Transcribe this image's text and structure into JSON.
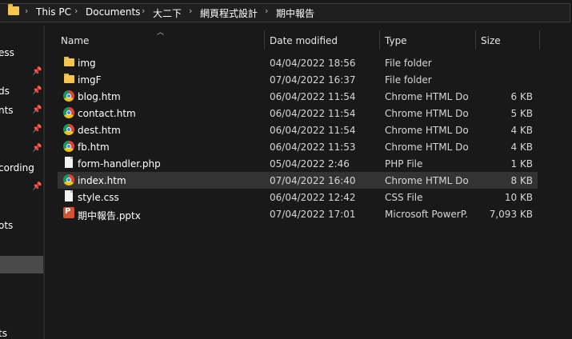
{
  "address": {
    "crumbs": [
      "This PC",
      "Documents",
      "大二下",
      "網頁程式設計",
      "期中報告"
    ]
  },
  "nav": {
    "items": [
      "ess",
      "ds",
      "nts",
      "cording",
      "ots",
      "ts"
    ]
  },
  "columns": {
    "name": "Name",
    "date": "Date modified",
    "type": "Type",
    "size": "Size"
  },
  "files": [
    {
      "name": "img",
      "date": "04/04/2022 18:56",
      "type": "File folder",
      "size": "",
      "icon": "folder-icon"
    },
    {
      "name": "imgF",
      "date": "07/04/2022 16:37",
      "type": "File folder",
      "size": "",
      "icon": "folder-icon"
    },
    {
      "name": "blog.htm",
      "date": "06/04/2022 11:54",
      "type": "Chrome HTML Do...",
      "size": "6 KB",
      "icon": "chrome-icon"
    },
    {
      "name": "contact.htm",
      "date": "06/04/2022 11:54",
      "type": "Chrome HTML Do...",
      "size": "5 KB",
      "icon": "chrome-icon"
    },
    {
      "name": "dest.htm",
      "date": "06/04/2022 11:54",
      "type": "Chrome HTML Do...",
      "size": "4 KB",
      "icon": "chrome-icon"
    },
    {
      "name": "fb.htm",
      "date": "06/04/2022 11:53",
      "type": "Chrome HTML Do...",
      "size": "4 KB",
      "icon": "chrome-icon"
    },
    {
      "name": "form-handler.php",
      "date": "05/04/2022 2:46",
      "type": "PHP File",
      "size": "1 KB",
      "icon": "document-icon"
    },
    {
      "name": "index.htm",
      "date": "07/04/2022 16:40",
      "type": "Chrome HTML Do...",
      "size": "8 KB",
      "icon": "chrome-icon"
    },
    {
      "name": "style.css",
      "date": "06/04/2022 12:42",
      "type": "CSS File",
      "size": "10 KB",
      "icon": "document-icon"
    },
    {
      "name": "期中報告.pptx",
      "date": "07/04/2022 17:01",
      "type": "Microsoft PowerP...",
      "size": "7,093 KB",
      "icon": "powerpoint-icon"
    }
  ]
}
